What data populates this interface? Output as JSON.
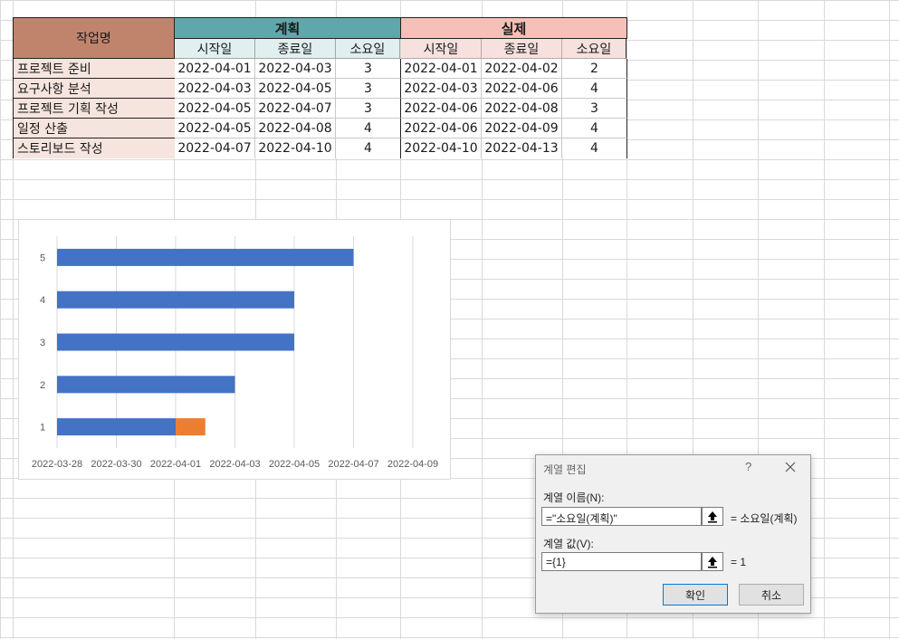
{
  "table": {
    "task_header": "작업명",
    "plan_header": "계획",
    "actual_header": "실제",
    "sub_headers": [
      "시작일",
      "종료일",
      "소요일"
    ],
    "rows": [
      {
        "task": "프로젝트 준비",
        "plan_start": "2022-04-01",
        "plan_end": "2022-04-03",
        "plan_days": "3",
        "actual_start": "2022-04-01",
        "actual_end": "2022-04-02",
        "actual_days": "2"
      },
      {
        "task": "요구사항 분석",
        "plan_start": "2022-04-03",
        "plan_end": "2022-04-05",
        "plan_days": "3",
        "actual_start": "2022-04-03",
        "actual_end": "2022-04-06",
        "actual_days": "4"
      },
      {
        "task": "프로젝트 기획 작성",
        "plan_start": "2022-04-05",
        "plan_end": "2022-04-07",
        "plan_days": "3",
        "actual_start": "2022-04-06",
        "actual_end": "2022-04-08",
        "actual_days": "3"
      },
      {
        "task": "일정 산출",
        "plan_start": "2022-04-05",
        "plan_end": "2022-04-08",
        "plan_days": "4",
        "actual_start": "2022-04-06",
        "actual_end": "2022-04-09",
        "actual_days": "4"
      },
      {
        "task": "스토리보드 작성",
        "plan_start": "2022-04-07",
        "plan_end": "2022-04-10",
        "plan_days": "4",
        "actual_start": "2022-04-10",
        "actual_end": "2022-04-13",
        "actual_days": "4"
      }
    ]
  },
  "chart_data": {
    "type": "bar",
    "orientation": "horizontal",
    "stacked": true,
    "categories": [
      "1",
      "2",
      "3",
      "4",
      "5"
    ],
    "x_ticks": [
      "2022-03-28",
      "2022-03-30",
      "2022-04-01",
      "2022-04-03",
      "2022-04-05",
      "2022-04-07",
      "2022-04-09"
    ],
    "xlim": [
      "2022-03-28",
      "2022-04-09"
    ],
    "series": [
      {
        "color": "#4472c4",
        "values": [
          "2022-04-01",
          "2022-04-03",
          "2022-04-05",
          "2022-04-05",
          "2022-04-07"
        ]
      },
      {
        "color": "#ed7d31",
        "values": [
          1,
          0,
          0,
          0,
          0
        ]
      }
    ],
    "grid": true
  },
  "dialog": {
    "title": "계열 편집",
    "help": "?",
    "name_label": "계열 이름(N):",
    "name_value": "=\"소요일(계획)\"",
    "name_preview": "= 소요일(계획)",
    "values_label": "계열 값(V):",
    "values_value": "={1}",
    "values_preview": "= 1",
    "ok_label": "확인",
    "cancel_label": "취소"
  }
}
